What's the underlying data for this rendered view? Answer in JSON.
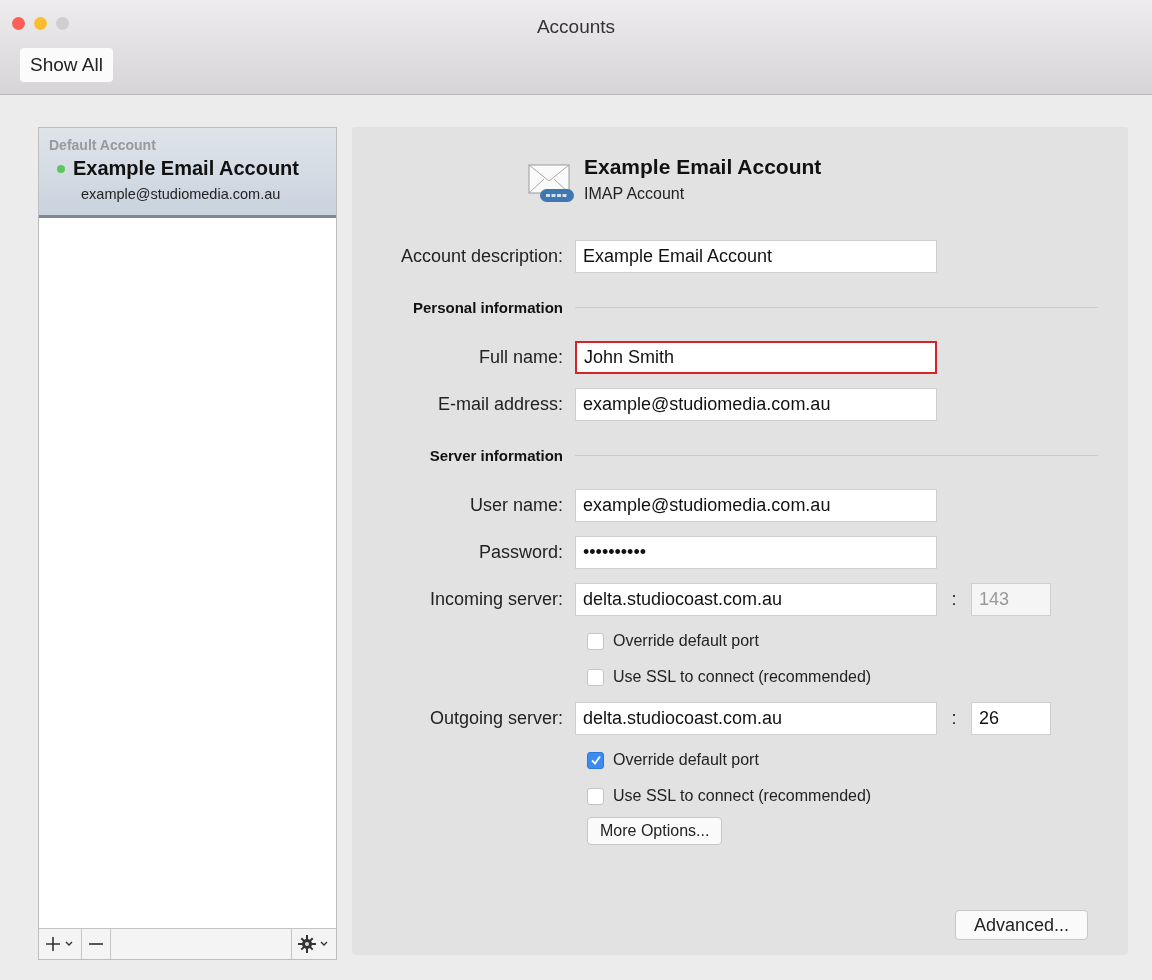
{
  "window": {
    "title": "Accounts"
  },
  "toolbar": {
    "show_all": "Show All"
  },
  "sidebar": {
    "group_label": "Default Account",
    "accounts": [
      {
        "name": "Example Email Account",
        "email": "example@studiomedia.com.au",
        "selected": true,
        "color": "#5ac95a"
      }
    ]
  },
  "account": {
    "name": "Example Email Account",
    "type": "IMAP Account"
  },
  "rows": [
    {
      "kind": "field",
      "label": "Account description:",
      "value": "Example Email Account",
      "highlighted": false
    },
    {
      "kind": "section",
      "label": "Personal information"
    },
    {
      "kind": "field",
      "label": "Full name:",
      "value": "John Smith",
      "highlighted": true
    },
    {
      "kind": "field",
      "label": "E-mail address:",
      "value": "example@studiomedia.com.au",
      "highlighted": false
    },
    {
      "kind": "section",
      "label": "Server information"
    },
    {
      "kind": "field",
      "label": "User name:",
      "value": "example@studiomedia.com.au",
      "highlighted": false
    },
    {
      "kind": "field",
      "label": "Password:",
      "value": "••••••••••",
      "highlighted": false
    },
    {
      "kind": "server",
      "label": "Incoming server:",
      "value": "delta.studiocoast.com.au",
      "separator": ":",
      "port": "143",
      "port_disabled": true
    },
    {
      "kind": "checkbox",
      "label": "Override default port",
      "checked": false
    },
    {
      "kind": "checkbox",
      "label": "Use SSL to connect (recommended)",
      "checked": false
    },
    {
      "kind": "server",
      "label": "Outgoing server:",
      "value": "delta.studiocoast.com.au",
      "separator": ":",
      "port": "26",
      "port_disabled": false
    },
    {
      "kind": "checkbox",
      "label": "Override default port",
      "checked": true
    },
    {
      "kind": "checkbox",
      "label": "Use SSL to connect (recommended)",
      "checked": false
    },
    {
      "kind": "button",
      "label": "More Options..."
    }
  ],
  "advanced": "Advanced..."
}
